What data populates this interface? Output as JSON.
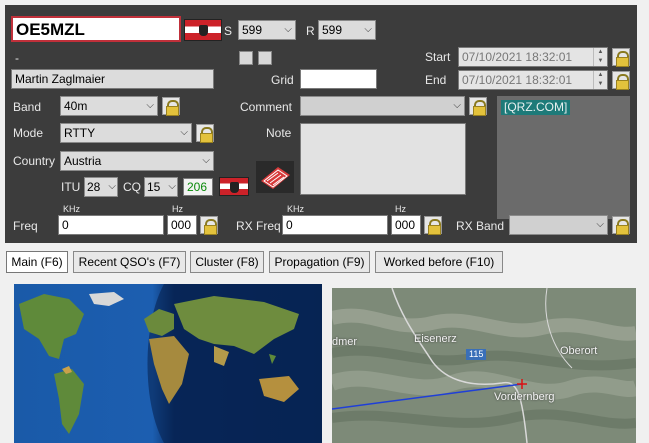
{
  "callsign": "OE5MZL",
  "name": "Martin Zaglmaier",
  "dash": "-",
  "rst": {
    "s_label": "S",
    "s_value": "599",
    "r_label": "R",
    "r_value": "599"
  },
  "start": {
    "label": "Start",
    "value": "07/10/2021 18:32:01"
  },
  "end": {
    "label": "End",
    "value": "07/10/2021 18:32:01"
  },
  "grid": {
    "label": "Grid",
    "value": ""
  },
  "band": {
    "label": "Band",
    "value": "40m"
  },
  "mode": {
    "label": "Mode",
    "value": "RTTY"
  },
  "country": {
    "label": "Country",
    "value": "Austria"
  },
  "comment": {
    "label": "Comment",
    "value": ""
  },
  "note": {
    "label": "Note",
    "value": ""
  },
  "itu": {
    "label": "ITU",
    "value": "28"
  },
  "cq": {
    "label": "CQ",
    "value": "15"
  },
  "dxcc_number": "206",
  "qrz_link": "[QRZ.COM]",
  "freq": {
    "label": "Freq",
    "khz_label": "KHz",
    "hz_label": "Hz",
    "khz_value": "0",
    "hz_value": "000"
  },
  "rx_freq": {
    "label": "RX Freq",
    "khz_label": "KHz",
    "hz_label": "Hz",
    "khz_value": "0",
    "hz_value": "000"
  },
  "rx_band": {
    "label": "RX Band",
    "value": ""
  },
  "tabs": [
    {
      "label": "Main (F6)",
      "active": true
    },
    {
      "label": "Recent QSO's (F7)"
    },
    {
      "label": "Cluster (F8)"
    },
    {
      "label": "Propagation (F9)"
    },
    {
      "label": "Worked before (F10)"
    }
  ],
  "topo_map": {
    "labels": [
      "Eisenerz",
      "Oberort",
      "Vordernberg",
      "115",
      "dmer"
    ]
  },
  "colors": {
    "panel": "#3c3c3c",
    "qrz_badge": "#1d7a79",
    "dxcc_number": "#0a8a0a",
    "path_line": "#1f3fd8"
  }
}
